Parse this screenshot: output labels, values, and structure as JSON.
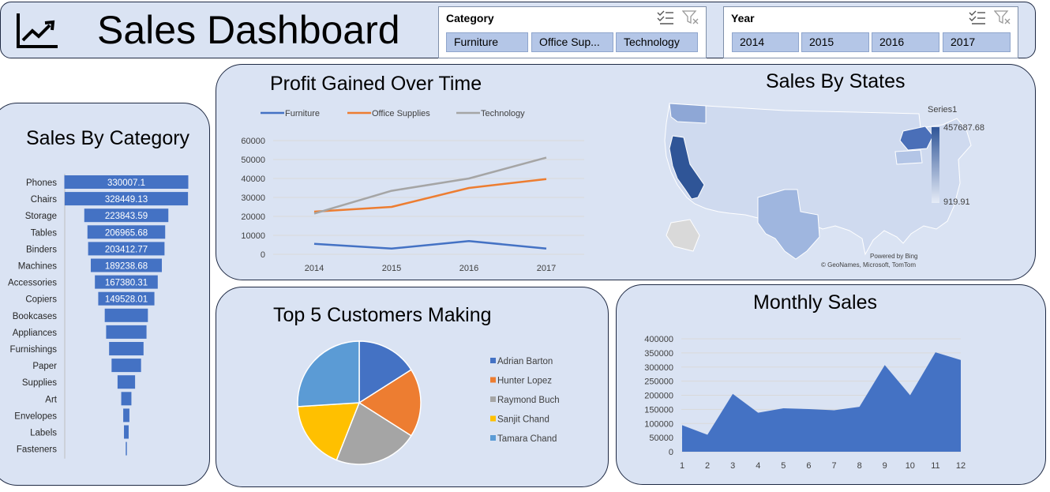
{
  "header": {
    "title": "Sales Dashboard",
    "icon": "line-chart-trend-icon"
  },
  "slicers": {
    "category": {
      "title": "Category",
      "items": [
        "Furniture",
        "Office Sup...",
        "Technology"
      ]
    },
    "year": {
      "title": "Year",
      "items": [
        "2014",
        "2015",
        "2016",
        "2017"
      ]
    },
    "tool_icons": [
      "multi-select-icon",
      "clear-filter-icon"
    ]
  },
  "panels": {
    "category_title": "Sales By Category",
    "profit_title": "Profit Gained Over Time",
    "states_title": "Sales By States",
    "top5_title": "Top 5 Customers Making",
    "monthly_title": "Monthly Sales"
  },
  "colors": {
    "panel_bg": "#dae3f3",
    "bar": "#4472c4",
    "furniture": "#4472c4",
    "office": "#ed7d31",
    "technology": "#a5a5a5"
  },
  "map": {
    "legend_title": "Series1",
    "legend_max": "457687.68",
    "legend_min": "919.91",
    "credit_powered": "Powered by Bing",
    "credit_source": "© GeoNames, Microsoft, TomTom"
  },
  "chart_data": [
    {
      "type": "bar",
      "orientation": "horizontal-funnel",
      "title": "Sales By Category",
      "categories": [
        "Phones",
        "Chairs",
        "Storage",
        "Tables",
        "Binders",
        "Machines",
        "Accessories",
        "Copiers",
        "Bookcases",
        "Appliances",
        "Furnishings",
        "Paper",
        "Supplies",
        "Art",
        "Envelopes",
        "Labels",
        "Fasteners"
      ],
      "values": [
        330007.1,
        328449.13,
        223843.59,
        206965.68,
        203412.77,
        189238.68,
        167380.31,
        149528.01,
        114880,
        107532,
        91705,
        78479,
        46674,
        27119,
        16476,
        12486,
        3024
      ],
      "value_labels": [
        "330007.1",
        "328449.13",
        "223843.59",
        "206965.68",
        "203412.77",
        "189238.68",
        "167380.31",
        "149528.01",
        "",
        "",
        "",
        "",
        "",
        "",
        "",
        "",
        ""
      ]
    },
    {
      "type": "line",
      "title": "Profit Gained Over Time",
      "x": [
        "2014",
        "2015",
        "2016",
        "2017"
      ],
      "series": [
        {
          "name": "Furniture",
          "values": [
            5500,
            3000,
            7000,
            3000
          ]
        },
        {
          "name": "Office Supplies",
          "values": [
            22500,
            25000,
            35000,
            39700
          ]
        },
        {
          "name": "Technology",
          "values": [
            21500,
            33500,
            40000,
            51000
          ]
        }
      ],
      "ylim": [
        0,
        60000
      ],
      "yticks": [
        "0",
        "10000",
        "20000",
        "30000",
        "40000",
        "50000",
        "60000"
      ],
      "legend": "top",
      "grid": true
    },
    {
      "type": "pie",
      "title": "Top 5 Customers Making",
      "labels": [
        "Adrian Barton",
        "Hunter Lopez",
        "Raymond Buch",
        "Sanjit Chand",
        "Tamara Chand"
      ],
      "values": [
        16,
        18,
        22,
        18,
        26
      ],
      "colors": [
        "#4472c4",
        "#ed7d31",
        "#a5a5a5",
        "#ffc000",
        "#5b9bd5"
      ],
      "legend": "right"
    },
    {
      "type": "area",
      "title": "Monthly Sales",
      "x": [
        "1",
        "2",
        "3",
        "4",
        "5",
        "6",
        "7",
        "8",
        "9",
        "10",
        "11",
        "12"
      ],
      "values": [
        94000,
        60000,
        205000,
        138000,
        154000,
        151000,
        147000,
        159000,
        307000,
        200000,
        352000,
        325000
      ],
      "ylim": [
        0,
        400000
      ],
      "yticks": [
        "0",
        "50000",
        "100000",
        "150000",
        "200000",
        "250000",
        "300000",
        "350000",
        "400000"
      ],
      "grid": true
    }
  ]
}
